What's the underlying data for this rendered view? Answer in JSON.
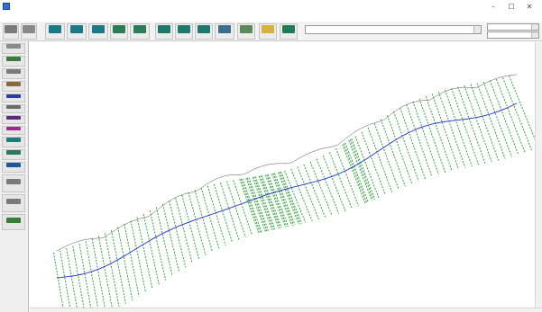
{
  "window": {
    "title": "",
    "min_glyph": "–",
    "max_glyph": "☐",
    "close_glyph": "✕"
  },
  "menu": [
    "",
    "",
    "",
    "",
    "",
    "",
    "",
    "",
    ""
  ],
  "toolbar": {
    "buttons": [
      {
        "label": "",
        "color": "#7a7a7a"
      },
      {
        "label": "",
        "color": "#8a8a8a"
      },
      {
        "label": "",
        "color": "#1b7a86"
      },
      {
        "label": "",
        "color": "#1b7a86"
      },
      {
        "label": "",
        "color": "#1b7a86"
      },
      {
        "label": "",
        "color": "#2a7d55"
      },
      {
        "label": "",
        "color": "#2a7d55"
      },
      {
        "label": "",
        "color": "#1d7a6a"
      },
      {
        "label": "",
        "color": "#1d7a6a"
      },
      {
        "label": "",
        "color": "#1d7a6a"
      },
      {
        "label": "",
        "color": "#3a6e8a"
      },
      {
        "label": "",
        "color": "#5a8a5a"
      },
      {
        "label": "",
        "color": "#d9b13a"
      },
      {
        "label": "",
        "color": "#1f7a55"
      }
    ],
    "combo_main": "",
    "combo_right_top": "",
    "combo_right_bottom": ""
  },
  "palette": [
    {
      "label": "",
      "color": "#8a8a8a"
    },
    {
      "label": "",
      "color": "#3c7a3c"
    },
    {
      "label": "",
      "color": "#7a7a7a"
    },
    {
      "label": "",
      "color": "#8a6a3a"
    },
    {
      "label": "",
      "color": "#2b3f99"
    },
    {
      "label": "",
      "color": "#6a6a6a"
    },
    {
      "label": "",
      "color": "#5a2a7a"
    },
    {
      "label": "",
      "color": "#a02a8a"
    },
    {
      "label": "",
      "color": "#1f7a7a"
    },
    {
      "label": "",
      "color": "#2a7a5a"
    },
    {
      "label": "",
      "color": "#1d5a9a"
    },
    {
      "label": "",
      "color": "#7a7a7a"
    },
    {
      "label": "",
      "color": "#7a7a7a"
    },
    {
      "label": "",
      "color": "#3a7a3a"
    }
  ],
  "colors": {
    "xs_line": "#1e9b2c",
    "water_surface": "#2233cc",
    "accent": "#1b7a86"
  }
}
